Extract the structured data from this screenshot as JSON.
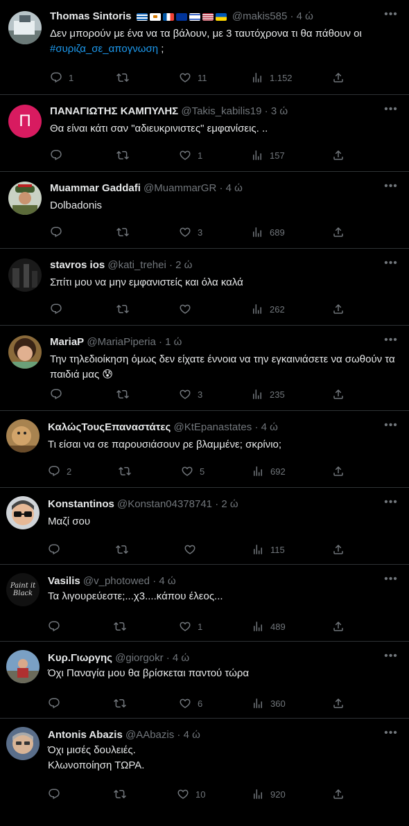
{
  "colors": {
    "background": "#000000",
    "text": "#e7e9ea",
    "muted": "#71767b",
    "link": "#1d9bf0",
    "divider": "#2f3336"
  },
  "more_icon": "more-horizontal-icon",
  "tweets": [
    {
      "name": "Thomas Sintoris",
      "handle": "@makis585",
      "time": "4 ώ",
      "flags": [
        "greece",
        "cyprus",
        "france",
        "eu",
        "israel",
        "usa",
        "ukraine"
      ],
      "text_before": "Δεν μπορούν με ένα να τα βάλουν, με 3 ταυτόχρονα τι θα πάθουν οι ",
      "hashtag": "#συριζα_σε_απογνωση",
      "text_after": " ;",
      "replies": "1",
      "retweets": "",
      "likes": "11",
      "views": "1.152"
    },
    {
      "name": "ΠΑΝΑΓΙΩΤΗΣ ΚΑΜΠΥΛΗΣ",
      "handle": "@Takis_kabilis19",
      "time": "3 ώ",
      "avatar_letter": "Π",
      "text": "Θα είναι κάτι σαν \"αδιευκρινιστες\" εμφανίσεις. ..",
      "replies": "",
      "retweets": "",
      "likes": "1",
      "views": "157"
    },
    {
      "name": "Muammar Gaddafi",
      "handle": "@MuammarGR",
      "time": "4 ώ",
      "text": "Dolbadonis",
      "replies": "",
      "retweets": "",
      "likes": "3",
      "views": "689"
    },
    {
      "name": "stavros ios",
      "handle": "@kati_trehei",
      "time": "2 ώ",
      "text": "Σπίτι μου να μην εμφανιστείς και όλα καλά",
      "replies": "",
      "retweets": "",
      "likes": "",
      "views": "262"
    },
    {
      "name": "MariaP",
      "handle": "@MariaPiperia",
      "time": "1 ώ",
      "text": "Την τηλεδιοίκηση όμως δεν είχατε έννοια να την εγκαινιάσετε να σωθούν τα παιδιά μας",
      "emoji": "😰",
      "replies": "",
      "retweets": "",
      "likes": "3",
      "views": "235"
    },
    {
      "name": "ΚαλώςΤουςΕπαναστάτες",
      "handle": "@KtEpanastates",
      "time": "4 ώ",
      "text": "Τι είσαι να σε παρουσιάσουν ρε βλαμμένε; σκρίνιο;",
      "replies": "2",
      "retweets": "",
      "likes": "5",
      "views": "692"
    },
    {
      "name": "Konstantinos",
      "handle": "@Konstan04378741",
      "time": "2 ώ",
      "text": "Μαζί σου",
      "replies": "",
      "retweets": "",
      "likes": "",
      "views": "115"
    },
    {
      "name": "Vasilis",
      "handle": "@v_photowed",
      "time": "4 ώ",
      "avatar_text": "Paint it Black",
      "text": "Τα λιγουρεύεστε;...χ3....κάπου έλεος...",
      "replies": "",
      "retweets": "",
      "likes": "1",
      "views": "489"
    },
    {
      "name": "Κυρ.Γιωργης",
      "handle": "@giorgokr",
      "time": "4 ώ",
      "text": "Όχι Παναγία μου θα βρίσκεται παντού τώρα",
      "replies": "",
      "retweets": "",
      "likes": "6",
      "views": "360"
    },
    {
      "name": "Antonis Abazis",
      "handle": "@AAbazis",
      "time": "4 ώ",
      "text_line1": "Όχι μισές δουλειές.",
      "text_line2": "Κλωνοποίηση ΤΩΡΑ.",
      "replies": "",
      "retweets": "",
      "likes": "10",
      "views": "920"
    }
  ]
}
